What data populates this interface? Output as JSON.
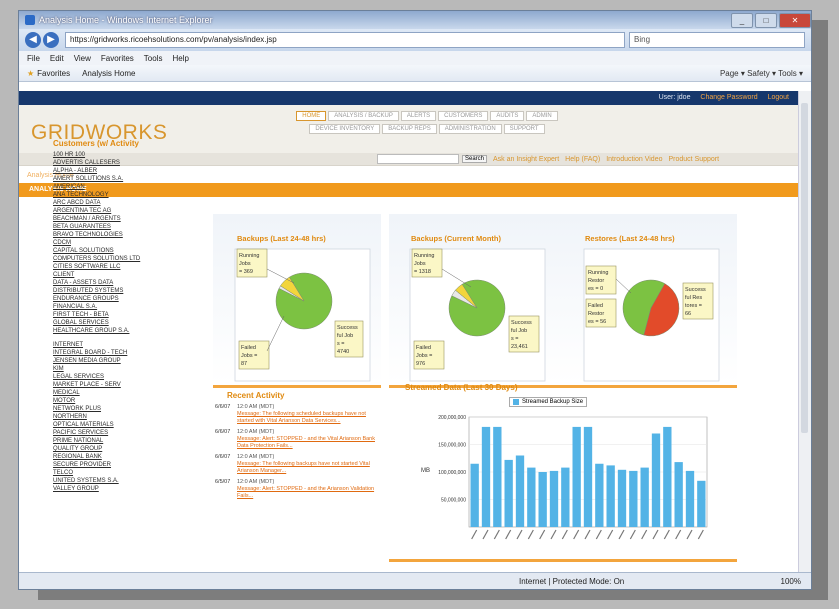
{
  "window": {
    "title": "Analysis Home - Windows Internet Explorer",
    "url": "https://gridworks.ricoehsolutions.com/pv/analysis/index.jsp",
    "search_placeholder": "Bing"
  },
  "menu": [
    "File",
    "Edit",
    "View",
    "Favorites",
    "Tools",
    "Help"
  ],
  "favorites": {
    "label": "Favorites",
    "tab": "Analysis Home",
    "tools": "Page ▾  Safety ▾  Tools ▾"
  },
  "top_strip": {
    "user": "User: jdoe",
    "change_password": "Change Password",
    "logout": "Logout"
  },
  "logo": {
    "text1": "GRID",
    "text2": "WORKS"
  },
  "nav_row1": [
    "HOME",
    "ANALYSIS / BACKUP",
    "ALERTS",
    "CUSTOMERS",
    "AUDITS",
    "ADMIN"
  ],
  "nav_row2": [
    "DEVICE INVENTORY",
    "BACKUP REPS",
    "ADMINISTRATION",
    "SUPPORT"
  ],
  "subbar": {
    "search_button": "Search",
    "links": [
      "Ask an Insight Expert",
      "Help (FAQ)",
      "Introduction Video",
      "Product Support"
    ]
  },
  "breadcrumb": "Analysis Home",
  "section_title": "ANALYSIS HOME",
  "customers": {
    "title": "Customers (w/ Activity",
    "items": [
      "100 HR 100",
      "ADVERTIS CALLESERS",
      "ALPHA - ALBER",
      "AMERT SOLUTIONS S.A.",
      "AMERICAN",
      "ANA TECHNOLOGY",
      "ARC ABCD DATA",
      "ARGENTINA TEC AG",
      "BEACHMAN / ARGENTS",
      "BETA GUARANTEES",
      "BRAVO TECHNOLOGIES",
      "CDCM",
      "CAPITAL SOLUTIONS",
      "COMPUTERS SOLUTIONS LTD",
      "CITIES SOFTWARE LLC",
      "CLIENT",
      "DATA - ASSETS DATA",
      "DISTRIBUTED SYSTEMS",
      "ENDURANCE GROUPS",
      "FINANCIAL S.A.",
      "FIRST TECH - BETA",
      "GLOBAL SERVICES",
      "HEALTHCARE GROUP S.A.",
      "",
      "INTERNET",
      "INTEGRAL BOARD - TECH",
      "JENSEN MEDIA GROUP",
      "KIM",
      "LEGAL SERVICES",
      "MARKET PLACE - SERV",
      "MEDICAL",
      "MOTOR",
      "NETWORK PLUS",
      "NORTHERN",
      "OPTICAL MATERIALS",
      "PACIFIC SERVICES",
      "PRIME NATIONAL",
      "QUALITY GROUP",
      "REGIONAL BANK",
      "SECURE PROVIDER",
      "TELCO",
      "UNITED SYSTEMS S.A.",
      "VALLEY GROUP"
    ]
  },
  "pie1": {
    "title": "Backups (Last 24-48 hrs)",
    "running": "Running Jobs = 369",
    "failed": "Failed Jobs = 87",
    "success": "Successful Jobs = 4740",
    "running_label": [
      "Running",
      "Jobs",
      "= 369"
    ],
    "failed_label": [
      "Failed",
      "Jobs =",
      "87"
    ],
    "success_label": [
      "Success",
      "ful Job",
      "s =",
      "4740"
    ]
  },
  "pie2": {
    "title": "Backups (Current Month)",
    "running_label": [
      "Running",
      "Jobs",
      "= 1318"
    ],
    "failed_label": [
      "Failed",
      "Jobs =",
      "976"
    ],
    "success_label": [
      "Success",
      "ful Job",
      "s =",
      "23,461"
    ]
  },
  "pie3": {
    "title": "Restores (Last 24-48 hrs)",
    "running_label": [
      "Running",
      "Restor",
      "es = 0"
    ],
    "failed_label": [
      "Failed",
      "Restor",
      "es = 56"
    ],
    "success_label": [
      "Success",
      "ful Res",
      "tores =",
      "66"
    ]
  },
  "recent": {
    "title": "Recent Activity",
    "items": [
      {
        "date": "6/6/07",
        "time": "12:0 AM (MDT)",
        "text": "Message: The following scheduled backups have not started with Vital Arianson Data Services..."
      },
      {
        "date": "6/6/07",
        "time": "12:0 AM (MDT)",
        "text": "Message: Alert: STOPPED - and the Vital Arianson Bank Data Protection Fails..."
      },
      {
        "date": "6/6/07",
        "time": "12:0 AM (MDT)",
        "text": "Message: The following backups have not started Vital Arianson Manager..."
      },
      {
        "date": "6/5/07",
        "time": "12:0 AM (MDT)",
        "text": "Message: Alert: STOPPED - and the Arianson Validation Fails..."
      }
    ]
  },
  "status": {
    "zone": "Internet | Protected Mode: On",
    "zoom": "100%"
  },
  "chart_data": [
    {
      "type": "pie",
      "title": "Backups (Last 24-48 hrs)",
      "labels": [
        "Successful Jobs",
        "Failed Jobs",
        "Running Jobs"
      ],
      "values": [
        4740,
        87,
        369
      ],
      "colors": [
        "#7cc242",
        "#e8e8e8",
        "#f2d53c"
      ]
    },
    {
      "type": "pie",
      "title": "Backups (Current Month)",
      "labels": [
        "Successful Jobs",
        "Failed Jobs",
        "Running Jobs"
      ],
      "values": [
        23461,
        976,
        1318
      ],
      "colors": [
        "#7cc242",
        "#e8e8e8",
        "#f2d53c"
      ]
    },
    {
      "type": "pie",
      "title": "Restores (Last 24-48 hrs)",
      "labels": [
        "Successful Restores",
        "Failed Restores",
        "Running Restores"
      ],
      "values": [
        66,
        56,
        0
      ],
      "colors": [
        "#7cc242",
        "#e24b2a",
        "#f2d53c"
      ]
    },
    {
      "type": "bar",
      "title": "Streamed Data (Last 30 Days)",
      "ylabel": "MB",
      "series": [
        {
          "name": "Streamed Backup Size",
          "values": [
            115,
            182,
            182,
            122,
            130,
            108,
            100,
            102,
            108,
            182,
            182,
            115,
            112,
            104,
            102,
            108,
            170,
            182,
            118,
            102,
            84
          ]
        }
      ],
      "ylim": [
        0,
        200
      ],
      "yticks": [
        "50,000,000",
        "100,000,000",
        "150,000,000",
        "200,000,000"
      ],
      "color": "#53b3e6"
    }
  ]
}
